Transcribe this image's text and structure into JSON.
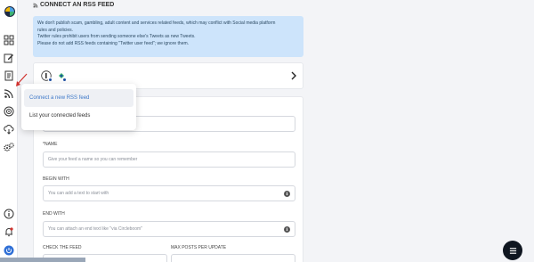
{
  "page": {
    "title": "CONNECT AN RSS FEED"
  },
  "alert": {
    "lines": [
      "We don't publish scam, gambling, adult content and services related feeds, which may conflict with Social media platform",
      "rules and policies.",
      "Twitter rules prohibit users from sending someone else's Tweets as new Tweets.",
      "Please do not add RSS feeds containing \"Twitter user feed\"; we ignore them."
    ]
  },
  "sidebar": {
    "items": [
      {
        "icon": "logo"
      },
      {
        "icon": "grid-icon"
      },
      {
        "icon": "edit-icon"
      },
      {
        "icon": "document-icon"
      },
      {
        "icon": "rss-icon"
      },
      {
        "icon": "target-icon"
      },
      {
        "icon": "cloud-download-icon"
      },
      {
        "icon": "gears-icon"
      },
      {
        "icon": "info-icon"
      },
      {
        "icon": "bell-icon"
      },
      {
        "icon": "power-icon"
      }
    ]
  },
  "popover": {
    "items": [
      {
        "label": "Connect a new RSS feed",
        "active": true
      },
      {
        "label": "List your connected feeds",
        "active": false
      }
    ]
  },
  "form": {
    "name_label": "NAME",
    "name_required_mark": "*",
    "name_placeholder": "Give your feed a name so you can remember",
    "begin_label": "BEGIN WITH",
    "begin_placeholder": "You can add a text to start with",
    "end_label": "END WITH",
    "end_placeholder": "You can attach an end text like \"via Circleboom\"",
    "check_label": "CHECK THE FEED",
    "max_label": "MAX POSTS PER UPDATE"
  },
  "colors": {
    "accent": "#3d78c8",
    "alert_bg": "#cde4fb",
    "fab_bg": "#0f1620",
    "arrow": "#d0312d"
  }
}
